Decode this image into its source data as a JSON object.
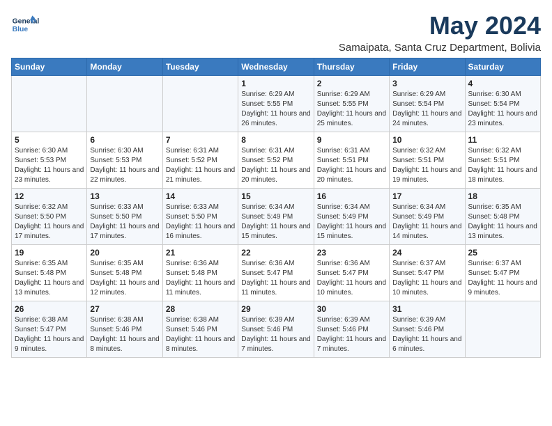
{
  "header": {
    "logo_general": "General",
    "logo_blue": "Blue",
    "month": "May 2024",
    "location": "Samaipata, Santa Cruz Department, Bolivia"
  },
  "columns": [
    "Sunday",
    "Monday",
    "Tuesday",
    "Wednesday",
    "Thursday",
    "Friday",
    "Saturday"
  ],
  "weeks": [
    [
      {
        "day": "",
        "info": ""
      },
      {
        "day": "",
        "info": ""
      },
      {
        "day": "",
        "info": ""
      },
      {
        "day": "1",
        "info": "Sunrise: 6:29 AM\nSunset: 5:55 PM\nDaylight: 11 hours and 26 minutes."
      },
      {
        "day": "2",
        "info": "Sunrise: 6:29 AM\nSunset: 5:55 PM\nDaylight: 11 hours and 25 minutes."
      },
      {
        "day": "3",
        "info": "Sunrise: 6:29 AM\nSunset: 5:54 PM\nDaylight: 11 hours and 24 minutes."
      },
      {
        "day": "4",
        "info": "Sunrise: 6:30 AM\nSunset: 5:54 PM\nDaylight: 11 hours and 23 minutes."
      }
    ],
    [
      {
        "day": "5",
        "info": "Sunrise: 6:30 AM\nSunset: 5:53 PM\nDaylight: 11 hours and 23 minutes."
      },
      {
        "day": "6",
        "info": "Sunrise: 6:30 AM\nSunset: 5:53 PM\nDaylight: 11 hours and 22 minutes."
      },
      {
        "day": "7",
        "info": "Sunrise: 6:31 AM\nSunset: 5:52 PM\nDaylight: 11 hours and 21 minutes."
      },
      {
        "day": "8",
        "info": "Sunrise: 6:31 AM\nSunset: 5:52 PM\nDaylight: 11 hours and 20 minutes."
      },
      {
        "day": "9",
        "info": "Sunrise: 6:31 AM\nSunset: 5:51 PM\nDaylight: 11 hours and 20 minutes."
      },
      {
        "day": "10",
        "info": "Sunrise: 6:32 AM\nSunset: 5:51 PM\nDaylight: 11 hours and 19 minutes."
      },
      {
        "day": "11",
        "info": "Sunrise: 6:32 AM\nSunset: 5:51 PM\nDaylight: 11 hours and 18 minutes."
      }
    ],
    [
      {
        "day": "12",
        "info": "Sunrise: 6:32 AM\nSunset: 5:50 PM\nDaylight: 11 hours and 17 minutes."
      },
      {
        "day": "13",
        "info": "Sunrise: 6:33 AM\nSunset: 5:50 PM\nDaylight: 11 hours and 17 minutes."
      },
      {
        "day": "14",
        "info": "Sunrise: 6:33 AM\nSunset: 5:50 PM\nDaylight: 11 hours and 16 minutes."
      },
      {
        "day": "15",
        "info": "Sunrise: 6:34 AM\nSunset: 5:49 PM\nDaylight: 11 hours and 15 minutes."
      },
      {
        "day": "16",
        "info": "Sunrise: 6:34 AM\nSunset: 5:49 PM\nDaylight: 11 hours and 15 minutes."
      },
      {
        "day": "17",
        "info": "Sunrise: 6:34 AM\nSunset: 5:49 PM\nDaylight: 11 hours and 14 minutes."
      },
      {
        "day": "18",
        "info": "Sunrise: 6:35 AM\nSunset: 5:48 PM\nDaylight: 11 hours and 13 minutes."
      }
    ],
    [
      {
        "day": "19",
        "info": "Sunrise: 6:35 AM\nSunset: 5:48 PM\nDaylight: 11 hours and 13 minutes."
      },
      {
        "day": "20",
        "info": "Sunrise: 6:35 AM\nSunset: 5:48 PM\nDaylight: 11 hours and 12 minutes."
      },
      {
        "day": "21",
        "info": "Sunrise: 6:36 AM\nSunset: 5:48 PM\nDaylight: 11 hours and 11 minutes."
      },
      {
        "day": "22",
        "info": "Sunrise: 6:36 AM\nSunset: 5:47 PM\nDaylight: 11 hours and 11 minutes."
      },
      {
        "day": "23",
        "info": "Sunrise: 6:36 AM\nSunset: 5:47 PM\nDaylight: 11 hours and 10 minutes."
      },
      {
        "day": "24",
        "info": "Sunrise: 6:37 AM\nSunset: 5:47 PM\nDaylight: 11 hours and 10 minutes."
      },
      {
        "day": "25",
        "info": "Sunrise: 6:37 AM\nSunset: 5:47 PM\nDaylight: 11 hours and 9 minutes."
      }
    ],
    [
      {
        "day": "26",
        "info": "Sunrise: 6:38 AM\nSunset: 5:47 PM\nDaylight: 11 hours and 9 minutes."
      },
      {
        "day": "27",
        "info": "Sunrise: 6:38 AM\nSunset: 5:46 PM\nDaylight: 11 hours and 8 minutes."
      },
      {
        "day": "28",
        "info": "Sunrise: 6:38 AM\nSunset: 5:46 PM\nDaylight: 11 hours and 8 minutes."
      },
      {
        "day": "29",
        "info": "Sunrise: 6:39 AM\nSunset: 5:46 PM\nDaylight: 11 hours and 7 minutes."
      },
      {
        "day": "30",
        "info": "Sunrise: 6:39 AM\nSunset: 5:46 PM\nDaylight: 11 hours and 7 minutes."
      },
      {
        "day": "31",
        "info": "Sunrise: 6:39 AM\nSunset: 5:46 PM\nDaylight: 11 hours and 6 minutes."
      },
      {
        "day": "",
        "info": ""
      }
    ]
  ]
}
